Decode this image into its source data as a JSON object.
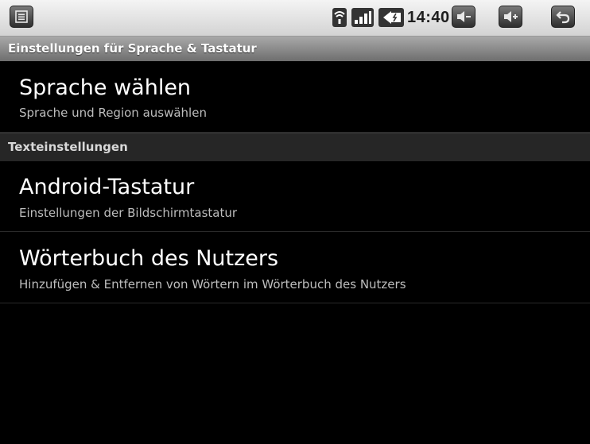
{
  "status_bar": {
    "time": "14:40",
    "icons": [
      "menu-icon",
      "wifi-icon",
      "signal-icon",
      "battery-icon",
      "volume-down-icon",
      "volume-up-icon",
      "back-icon"
    ]
  },
  "title_bar": {
    "title": "Einstellungen für Sprache & Tastatur"
  },
  "items": [
    {
      "title": "Sprache wählen",
      "summary": "Sprache und Region auswählen"
    },
    {
      "title": "Android-Tastatur",
      "summary": "Einstellungen der Bildschirmtastatur"
    },
    {
      "title": "Wörterbuch des Nutzers",
      "summary": "Hinzufügen & Entfernen von Wörtern im Wörterbuch des Nutzers"
    }
  ],
  "categories": [
    "Texteinstellungen"
  ],
  "colors": {
    "status_bar_bg": "#e2e2e2",
    "title_bar_bg": "#8c8c8c",
    "category_bg": "#262626",
    "background": "#000000",
    "summary_text": "#bdbdbd"
  }
}
